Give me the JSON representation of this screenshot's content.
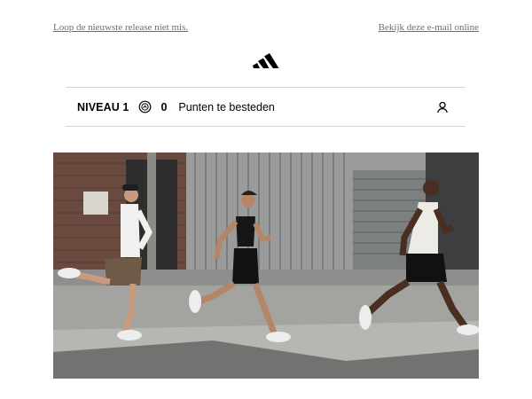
{
  "header": {
    "left_link": "Loop de nieuwste release niet mis.",
    "right_link": "Bekijk deze e-mail online"
  },
  "brand": {
    "logo_icon": "adidas-logo-icon"
  },
  "loyalty": {
    "level": "NIVEAU 1",
    "points": "0",
    "points_label": "Punten te besteden",
    "coin_icon": "points-coin-icon",
    "account_icon": "user-icon"
  },
  "hero": {
    "image_icon": "hero-runners-image"
  },
  "colors": {
    "link": "#6e6e6e",
    "divider": "#d4d4d4",
    "text": "#000000"
  }
}
